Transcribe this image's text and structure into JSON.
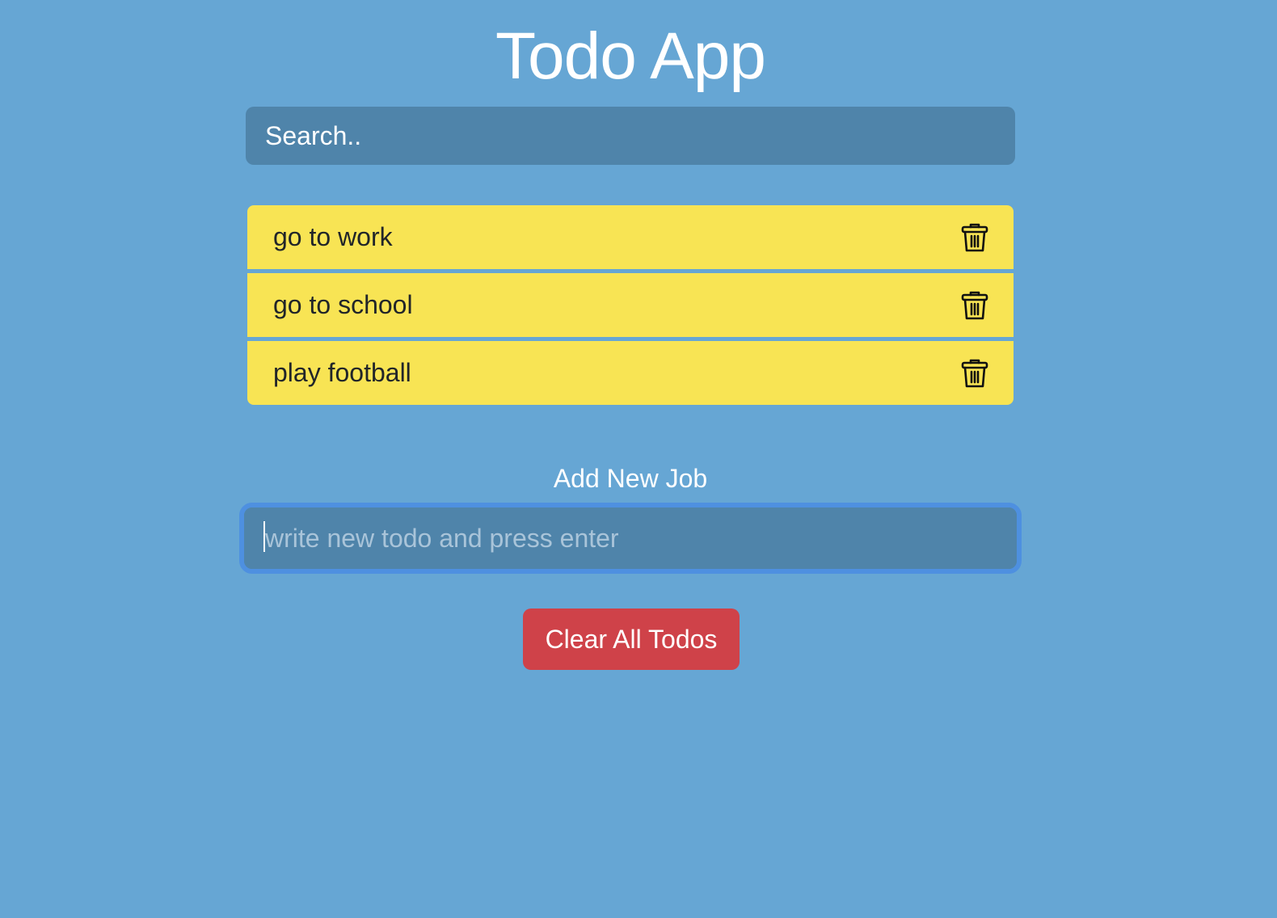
{
  "app": {
    "title": "Todo App"
  },
  "search": {
    "text": "Search.."
  },
  "todos": [
    {
      "text": "go to work",
      "icon": "trash-icon"
    },
    {
      "text": "go to school",
      "icon": "trash-icon"
    },
    {
      "text": "play football",
      "icon": "trash-icon"
    }
  ],
  "add": {
    "label": "Add New Job",
    "placeholder": "write new todo and press enter",
    "value": ""
  },
  "clear": {
    "label": "Clear All Todos"
  },
  "colors": {
    "background": "#66a6d4",
    "input_background": "#4f84aa",
    "todo_background": "#f8e454",
    "focus_ring": "#4e90e0",
    "danger": "#cf4249"
  }
}
